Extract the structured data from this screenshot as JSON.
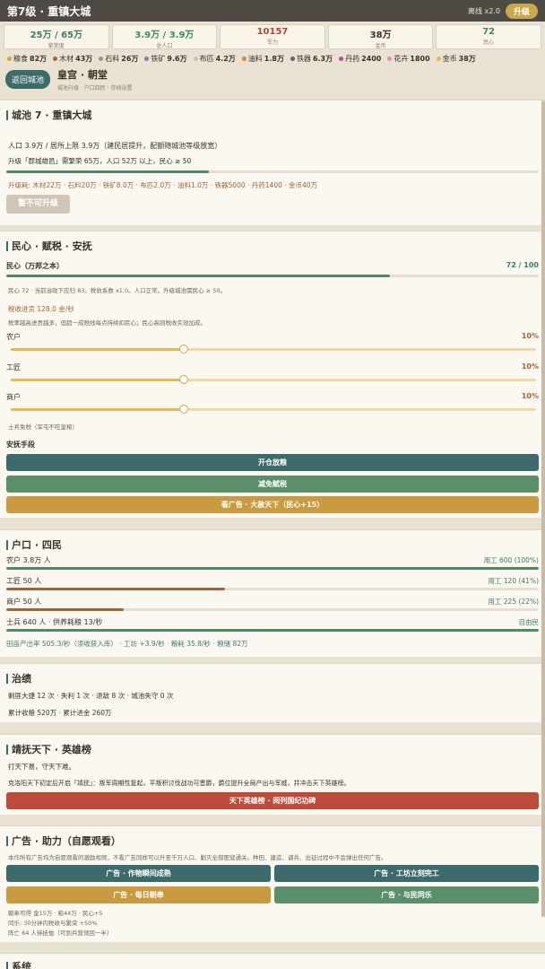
{
  "topbar": {
    "title": "第7级 · 重镇大城",
    "offline": "离线 x2.0",
    "upgrade": "升级"
  },
  "stats": [
    {
      "value": "25万 / 65万",
      "label": "繁荣度",
      "color": "#3d7b6b"
    },
    {
      "value": "3.9万 / 3.9万",
      "label": "总人口",
      "color": "#3d8b5b"
    },
    {
      "value": "10157",
      "label": "军力",
      "color": "#b04434"
    },
    {
      "value": "38万",
      "label": "金币",
      "color": "#3a3228"
    },
    {
      "value": "72",
      "label": "民心",
      "color": "#3d8b5b"
    }
  ],
  "resources": [
    {
      "name": "粮食",
      "value": "82万",
      "color": "#d9a531"
    },
    {
      "name": "木材",
      "value": "43万",
      "color": "#a0643a"
    },
    {
      "name": "石料",
      "value": "26万",
      "color": "#9a9288"
    },
    {
      "name": "铁矿",
      "value": "9.6万",
      "color": "#7a86a0"
    },
    {
      "name": "布匹",
      "value": "4.2万",
      "color": "#c9c2b6"
    },
    {
      "name": "油料",
      "value": "1.8万",
      "color": "#d08a30"
    },
    {
      "name": "铁器",
      "value": "6.3万",
      "color": "#5a6478"
    },
    {
      "name": "丹药",
      "value": "2400",
      "color": "#c04aa0"
    },
    {
      "name": "花卉",
      "value": "1800",
      "color": "#e38ab8"
    },
    {
      "name": "金币",
      "value": "38万",
      "color": "#e3b93a"
    }
  ],
  "nav": {
    "back": "返回城池",
    "title": "皇宫 · 朝堂",
    "subtitle": "城池升级 · 户口四民 · 存档设置"
  },
  "city": {
    "heading": "城池 7 · 重镇大城",
    "population": "人口 3.9万 / 居所上限 3.9万（建民居提升，配额随城池等级放宽）",
    "requirement": "升级「郡城雄邑」需繁荣 65万，人口 52万 以上，民心 ≥ 50",
    "progress": 0.38,
    "cost": "升级耗: 木材22万 · 石料20万 · 铁矿8.0万 · 布匹2.0万 · 油料1.0万 · 铁器5000 · 丹药1400 · 金币40万",
    "button": "暂不可升级"
  },
  "morale": {
    "heading": "民心 · 赋税 · 安抚",
    "label": "民心（万邦之本）",
    "value": "72 / 100",
    "progress": 0.72,
    "note": "民心 72 · 当前治政下应归 83。税收系数 x1.0。人口正常。升级城池需民心 ≥ 50。",
    "tax_income": "税收进贡 128.0 金/秒",
    "tax_note": "税率越高进贡越多，但超一成税线每点持续扣民心；民心高则税收实效加成。",
    "sliders": [
      {
        "label": "农户",
        "value": "10%",
        "level": 0.33
      },
      {
        "label": "工匠",
        "value": "10%",
        "level": 0.33
      },
      {
        "label": "商户",
        "value": "10%",
        "level": 0.33
      }
    ],
    "soldier_note": "士兵免税（军屯不吃皇粮）",
    "pacify_label": "安抚手段",
    "btn_open": "开仓放粮",
    "btn_reduce": "减免赋税",
    "btn_ad": "看广告 · 大赦天下（民心+15）"
  },
  "households": {
    "heading": "户口 · 四民",
    "rows": [
      {
        "label": "农户 3.8万 人",
        "right": "用工 600 (100%)",
        "level": 1.0,
        "color": "#4e8a62"
      },
      {
        "label": "工匠 50 人",
        "right": "用工 120 (41%)",
        "level": 0.41,
        "color": "#a0643a"
      },
      {
        "label": "商户 50 人",
        "right": "用工 225 (22%)",
        "level": 0.22,
        "color": "#a0643a"
      },
      {
        "label": "士兵 640 人 · 供养耗粮 13/秒",
        "right": "自由民",
        "level": 1.0,
        "color": "#4e8a62"
      }
    ],
    "summary": "田亩产出率 505.3/秒（须收获入库） · 工坊 +3.9/秒 · 粮耗 35.8/秒 · 粮储 82万"
  },
  "governance": {
    "heading": "治绩",
    "line1": "剿匪大捷 12 次 · 失利 1 次 · 退敌 8 次 · 城池失守 0 次",
    "line2": "累计收粮 520万 · 累计进金 260万"
  },
  "heroes": {
    "heading": "靖抚天下 · 英雄榜",
    "line1": "打天下易，守天下难。",
    "line2": "克洛阳天下初定后开启「靖抚」：叛军周期性复起，平叛积讨伐战功可晋爵，爵位提升全局产出与军威，并冲击天下英雄榜。",
    "button": "天下英雄榜 · 阅列国纪功碑"
  },
  "ads": {
    "heading": "广告 · 助力（自愿观看）",
    "note": "本作所有广告均为自愿观看的激励视频，不看广告同样可以升至千万人口、剿灭全部匪寇通关。种田、建造、调兵、出征过程中不会弹出任何广告。",
    "btn1": "广告 · 作物瞬间成熟",
    "btn2": "广告 · 工坊立刻完工",
    "btn3": "广告 · 每日朝奉",
    "btn4": "广告 · 与民同乐",
    "footer1": "朝奉可得 金15万 · 粮44万 · 民心+5",
    "footer2": "同乐: 30分钟内税收与繁荣 +50%",
    "footer3": "阵亡 64 人待抚恤（可到兵营领回一半）"
  },
  "system": {
    "heading": "系统"
  }
}
